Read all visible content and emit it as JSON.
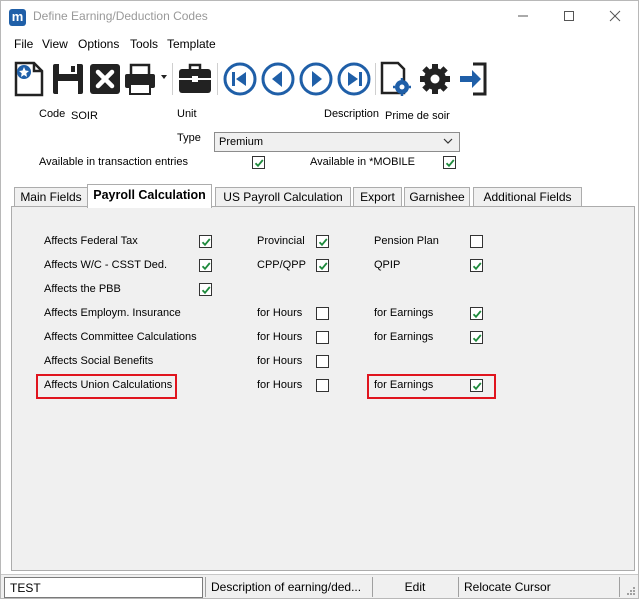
{
  "window": {
    "title": "Define Earning/Deduction Codes",
    "logo_letter": "m"
  },
  "menu": [
    "File",
    "View",
    "Options",
    "Tools",
    "Template"
  ],
  "toolbar_icons": [
    "new-record-icon",
    "save-icon",
    "delete-icon",
    "print-icon",
    "briefcase-icon",
    "first-record-icon",
    "previous-record-icon",
    "next-record-icon",
    "last-record-icon",
    "settings-document-icon",
    "gear-icon",
    "exit-icon"
  ],
  "header": {
    "code_label": "Code",
    "code_value": "SOIR",
    "unit_label": "Unit",
    "description_label": "Description",
    "description_value": "Prime de soir",
    "type_label": "Type",
    "type_value": "Premium",
    "available_transaction_label": "Available in transaction entries",
    "available_transaction_checked": true,
    "available_mobile_label": "Available in *MOBILE",
    "available_mobile_checked": true
  },
  "tabs": [
    "Main Fields",
    "Payroll Calculation",
    "US Payroll Calculation",
    "Export",
    "Garnishee",
    "Additional Fields"
  ],
  "active_tab": "Payroll Calculation",
  "payroll": {
    "affects_federal_tax": {
      "label": "Affects Federal Tax",
      "checked": true
    },
    "affects_wc": {
      "label": "Affects W/C - CSST Ded.",
      "checked": true
    },
    "affects_pbb": {
      "label": "Affects the PBB",
      "checked": true
    },
    "affects_ei": {
      "label": "Affects Employm. Insurance"
    },
    "affects_committee": {
      "label": "Affects Committee Calculations"
    },
    "affects_social": {
      "label": "Affects Social Benefits"
    },
    "affects_union": {
      "label": "Affects Union Calculations"
    },
    "provincial": {
      "label": "Provincial",
      "checked": true
    },
    "cpp_qpp": {
      "label": "CPP/QPP",
      "checked": true
    },
    "pension_plan": {
      "label": "Pension Plan",
      "checked": false
    },
    "qpip": {
      "label": "QPIP",
      "checked": true
    },
    "ei_hours": {
      "label": "for Hours",
      "checked": false
    },
    "ei_earnings": {
      "label": "for Earnings",
      "checked": true
    },
    "committee_hours": {
      "label": "for Hours",
      "checked": false
    },
    "committee_earnings": {
      "label": "for Earnings",
      "checked": true
    },
    "social_hours": {
      "label": "for Hours",
      "checked": false
    },
    "union_hours": {
      "label": "for Hours",
      "checked": false
    },
    "union_earnings": {
      "label": "for Earnings",
      "checked": true
    }
  },
  "status": {
    "input_value": "TEST",
    "description": "Description of earning/ded...",
    "mode": "Edit",
    "hint": "Relocate Cursor"
  },
  "colors": {
    "highlight": "#e0141e",
    "icon_blue": "#1f5fa8",
    "check_green": "#1e8a3c"
  }
}
